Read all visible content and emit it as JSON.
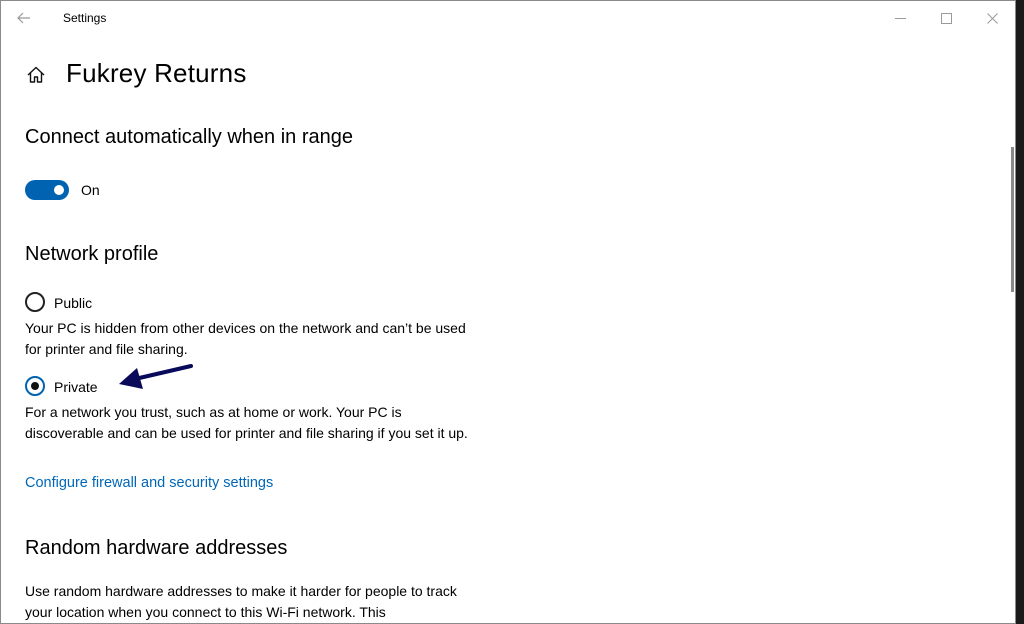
{
  "titlebar": {
    "title": "Settings"
  },
  "header": {
    "title": "Fukrey Returns"
  },
  "connect": {
    "heading": "Connect automatically when in range",
    "toggle_state": "On"
  },
  "network_profile": {
    "heading": "Network profile",
    "public_label": "Public",
    "public_desc": "Your PC is hidden from other devices on the network and can’t be used for printer and file sharing.",
    "private_label": "Private",
    "private_desc": "For a network you trust, such as at home or work. Your PC is discoverable and can be used for printer and file sharing if you set it up.",
    "selected": "Private",
    "firewall_link": "Configure firewall and security settings"
  },
  "random_hw": {
    "heading": "Random hardware addresses",
    "desc": "Use random hardware addresses to make it harder for people to track your location when you connect to this Wi-Fi network. This"
  },
  "colors": {
    "accent": "#0063b1",
    "link": "#0067b8",
    "annotation_arrow": "#0a0a5a"
  },
  "icons": {
    "back": "back-arrow-icon",
    "home": "home-icon",
    "minimize": "minimize-icon",
    "maximize": "maximize-icon",
    "close": "close-icon"
  }
}
